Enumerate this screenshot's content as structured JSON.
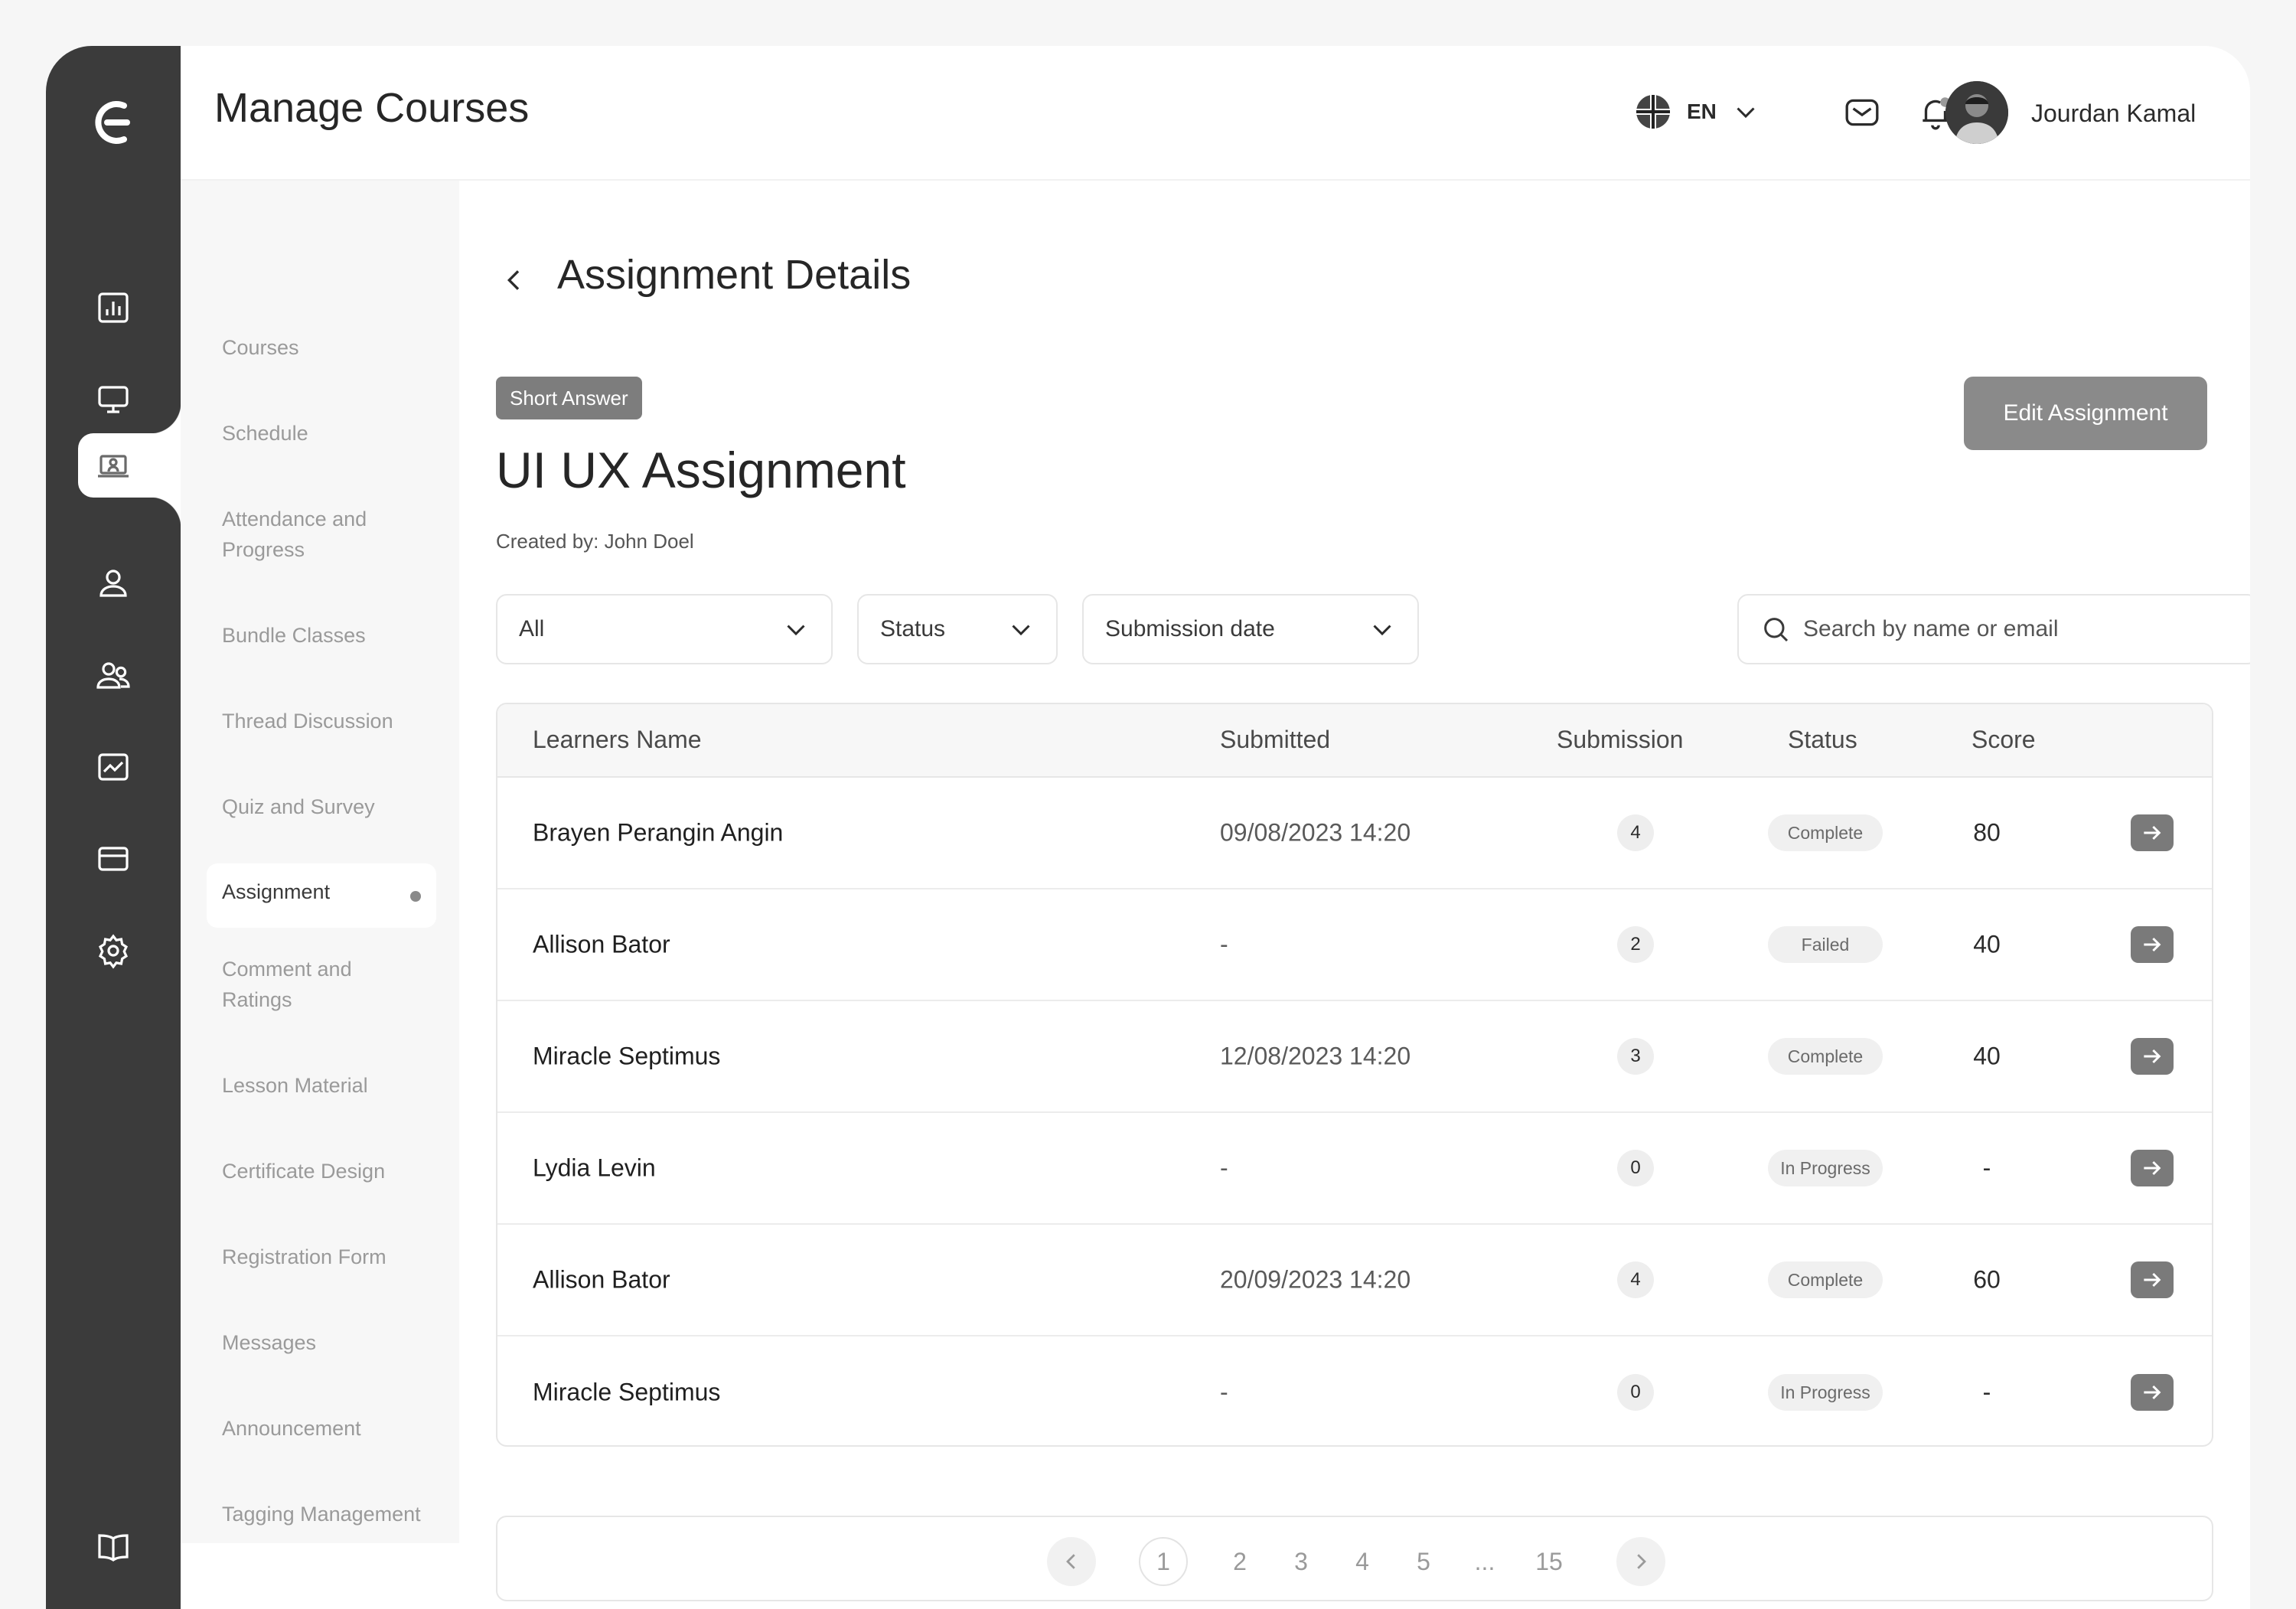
{
  "header": {
    "title": "Manage Courses",
    "language": "EN",
    "user_name": "Jourdan Kamal"
  },
  "rail": {
    "icons": [
      "dashboard-icon",
      "monitor-icon",
      "classroom-icon",
      "user-icon",
      "users-icon",
      "analytics-icon",
      "card-icon",
      "settings-icon",
      "book-icon"
    ],
    "active": "classroom-icon"
  },
  "subnav": {
    "items": [
      "Courses",
      "Schedule",
      "Attendance and Progress",
      "Bundle Classes",
      "Thread Discussion",
      "Quiz and Survey",
      "Assignment",
      "Comment and Ratings",
      "Lesson Material",
      "Certificate Design",
      "Registration Form",
      "Messages",
      "Announcement",
      "Tagging Management"
    ],
    "active": "Assignment"
  },
  "main": {
    "title": "Assignment Details",
    "tag": "Short Answer",
    "assignment_title": "UI UX Assignment",
    "created_by": "Created by: John Doel",
    "edit_button": "Edit Assignment",
    "filters": {
      "type": "All",
      "status": "Status",
      "date": "Submission date"
    },
    "search_placeholder": "Search by name or email"
  },
  "table": {
    "columns": [
      "Learners Name",
      "Submitted",
      "Submission",
      "Status",
      "Score"
    ],
    "rows": [
      {
        "name": "Brayen Perangin Angin",
        "submitted": "09/08/2023 14:20",
        "submission": "4",
        "status": "Complete",
        "score": "80"
      },
      {
        "name": "Allison Bator",
        "submitted": "-",
        "submission": "2",
        "status": "Failed",
        "score": "40"
      },
      {
        "name": "Miracle Septimus",
        "submitted": "12/08/2023 14:20",
        "submission": "3",
        "status": "Complete",
        "score": "40"
      },
      {
        "name": "Lydia Levin",
        "submitted": "-",
        "submission": "0",
        "status": "In Progress",
        "score": "-"
      },
      {
        "name": "Allison Bator",
        "submitted": "20/09/2023 14:20",
        "submission": "4",
        "status": "Complete",
        "score": "60"
      },
      {
        "name": "Miracle Septimus",
        "submitted": "-",
        "submission": "0",
        "status": "In Progress",
        "score": "-"
      }
    ]
  },
  "pagination": {
    "pages": [
      "1",
      "2",
      "3",
      "4",
      "5",
      "...",
      "15"
    ],
    "current": "1"
  }
}
